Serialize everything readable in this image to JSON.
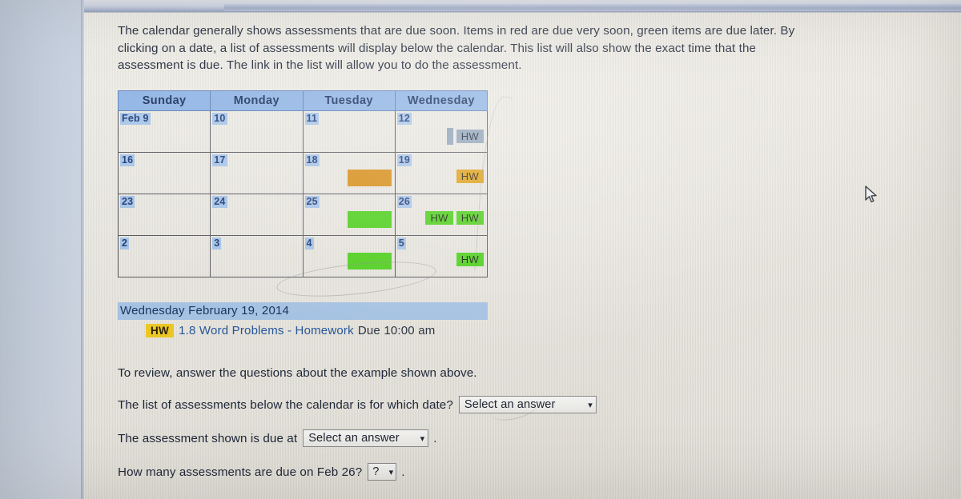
{
  "intro": {
    "paragraph": "The calendar generally shows assessments that are due soon. Items in red are due very soon, green items are due later. By clicking on a date, a list of assessments will display below the calendar. This list will also show the exact time that the assessment is due. The link in the list will allow you to do the assessment."
  },
  "calendar": {
    "headers": [
      "Sunday",
      "Monday",
      "Tuesday",
      "Wednesday"
    ],
    "weeks": [
      [
        {
          "day": "Feb 9",
          "items": []
        },
        {
          "day": "10",
          "items": []
        },
        {
          "day": "11",
          "items": []
        },
        {
          "day": "12",
          "items": [
            {
              "kind": "block",
              "color": "gray",
              "label": ""
            },
            {
              "kind": "chip",
              "color": "gray",
              "label": "HW"
            }
          ]
        }
      ],
      [
        {
          "day": "16",
          "items": []
        },
        {
          "day": "17",
          "items": []
        },
        {
          "day": "18",
          "items": [
            {
              "kind": "block",
              "color": "orange",
              "label": ""
            }
          ]
        },
        {
          "day": "19",
          "selected": true,
          "items": [
            {
              "kind": "chip",
              "color": "orange",
              "label": "HW"
            }
          ]
        }
      ],
      [
        {
          "day": "23",
          "items": []
        },
        {
          "day": "24",
          "items": []
        },
        {
          "day": "25",
          "items": [
            {
              "kind": "block",
              "color": "green",
              "label": ""
            }
          ]
        },
        {
          "day": "26",
          "items": [
            {
              "kind": "chip",
              "color": "green",
              "label": "HW"
            },
            {
              "kind": "chip",
              "color": "green",
              "label": "HW"
            }
          ]
        }
      ],
      [
        {
          "day": "2",
          "items": []
        },
        {
          "day": "3",
          "items": []
        },
        {
          "day": "4",
          "items": [
            {
              "kind": "block",
              "color": "green",
              "label": ""
            }
          ]
        },
        {
          "day": "5",
          "items": [
            {
              "kind": "chip",
              "color": "green",
              "label": "HW"
            }
          ]
        }
      ]
    ]
  },
  "selected_date_list": {
    "date_heading": "Wednesday February 19, 2014",
    "entries": [
      {
        "tag": "HW",
        "title": "1.8 Word Problems - Homework",
        "due": "Due 10:00 am"
      }
    ]
  },
  "questions": {
    "review_prompt": "To review, answer the questions about the example shown above.",
    "items": [
      {
        "text": "The list of assessments below the calendar is for which date?",
        "dropdown_value": "Select an answer",
        "tail": ""
      },
      {
        "text": "The assessment shown is due at",
        "dropdown_value": "Select an answer",
        "tail": "."
      },
      {
        "text": "How many assessments are due on Feb 26?",
        "dropdown_value": "?",
        "tail": "."
      }
    ]
  },
  "icons": {
    "caret": "⌄",
    "cursor": "mouse-pointer-arrow"
  },
  "colors": {
    "header_blue": "#8fb4e6",
    "daynum_blue": "#a8c6ea",
    "selected_pink": "#e7bcd8",
    "green": "#4ed21a",
    "orange": "#d98e16",
    "gray_block": "#8ea2b8",
    "hw_tag_yellow": "#f2cc20",
    "link_blue": "#23559c"
  }
}
